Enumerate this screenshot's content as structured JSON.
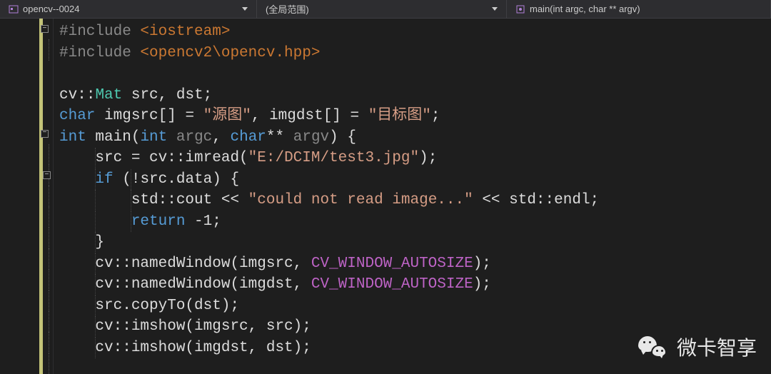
{
  "toolbar": {
    "project_label": "opencv--0024",
    "scope_label": "(全局范围)",
    "function_label": "main(int argc, char ** argv)"
  },
  "collapse": {
    "minus": "−"
  },
  "code": {
    "l0": {
      "a": "#include ",
      "b": "<iostream>"
    },
    "l1": {
      "a": "#include ",
      "b": "<opencv2\\opencv.hpp>"
    },
    "l2": "",
    "l3": {
      "a": "cv",
      "b": "::",
      "c": "Mat",
      "d": " src, dst;"
    },
    "l4": {
      "a": "char",
      "b": " imgsrc[] = ",
      "c": "\"源图\"",
      "d": ", imgdst[] = ",
      "e": "\"目标图\"",
      "f": ";"
    },
    "l5": {
      "a": "int",
      "b": " main(",
      "c": "int",
      "d": " ",
      "e": "argc",
      "f": ", ",
      "g": "char",
      "h": "** ",
      "i": "argv",
      "j": ") {"
    },
    "l6": {
      "a": "    src = cv::imread(",
      "b": "\"E:/DCIM/test3.jpg\"",
      "c": ");"
    },
    "l7": {
      "a": "    ",
      "b": "if",
      "c": " (!src.data) {"
    },
    "l8": {
      "a": "        std::cout << ",
      "b": "\"could not read image...\"",
      "c": " << std::endl;"
    },
    "l9": {
      "a": "        ",
      "b": "return",
      "c": " -1;"
    },
    "l10": "    }",
    "l11": {
      "a": "    cv::namedWindow(imgsrc, ",
      "b": "CV_WINDOW_AUTOSIZE",
      "c": ");"
    },
    "l12": {
      "a": "    cv::namedWindow(imgdst, ",
      "b": "CV_WINDOW_AUTOSIZE",
      "c": ");"
    },
    "l13": "    src.copyTo(dst);",
    "l14": "    cv::imshow(imgsrc, src);",
    "l15": "    cv::imshow(imgdst, dst);"
  },
  "watermark": {
    "text": "微卡智享"
  }
}
